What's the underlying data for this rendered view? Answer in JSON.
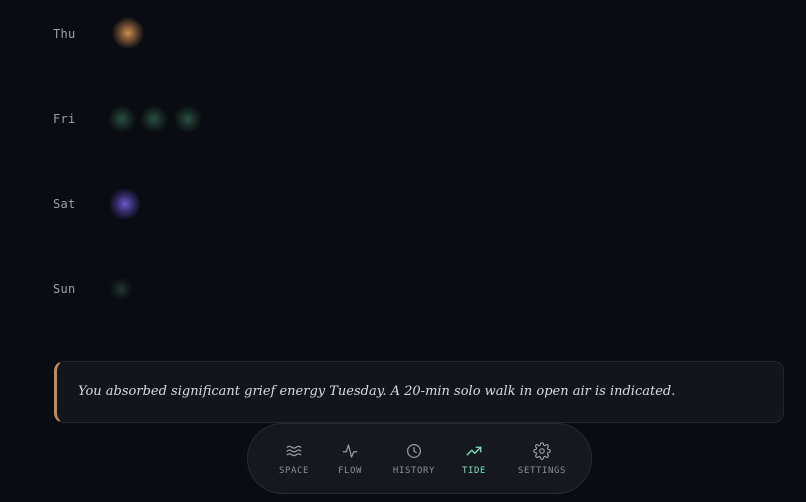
{
  "week": {
    "days": [
      {
        "label": "Thu"
      },
      {
        "label": "Fri"
      },
      {
        "label": "Sat"
      },
      {
        "label": "Sun"
      }
    ]
  },
  "insight": {
    "text": "You absorbed significant grief energy Tuesday. A 20-min solo walk in open air is indicated.",
    "accent_color": "#c98a52"
  },
  "nav": {
    "items": [
      {
        "label": "SPACE",
        "icon": "waves-icon"
      },
      {
        "label": "FLOW",
        "icon": "pulse-icon"
      },
      {
        "label": "HISTORY",
        "icon": "clock-icon"
      },
      {
        "label": "TIDE",
        "icon": "trending-up-icon",
        "active": true
      },
      {
        "label": "SETTINGS",
        "icon": "gear-icon"
      }
    ],
    "active_color": "#7fe0bd"
  },
  "colors": {
    "background": "#090c12",
    "orb_thu": "#d69656",
    "orb_fri": "#2e5846",
    "orb_sat": "#745cd6",
    "orb_sun": "#263c34"
  }
}
